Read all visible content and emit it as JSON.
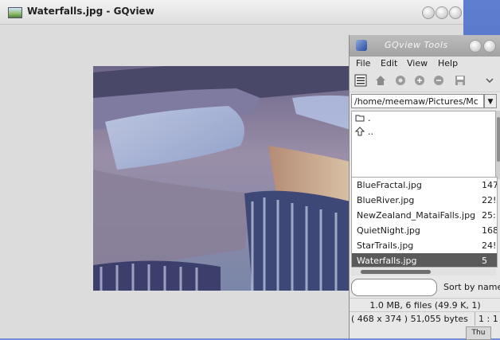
{
  "main_window": {
    "title": "Waterfalls.jpg - GQview"
  },
  "tools_window": {
    "title": "GQview Tools",
    "menu": [
      "File",
      "Edit",
      "View",
      "Help"
    ],
    "path": "/home/meemaw/Pictures/Mc",
    "dirs": [
      ".",
      ".."
    ],
    "files": [
      {
        "name": "BlueFractal.jpg",
        "size": "147"
      },
      {
        "name": "BlueRiver.jpg",
        "size": "22!"
      },
      {
        "name": "NewZealand_MataiFalls.jpg",
        "size": "25:"
      },
      {
        "name": "QuietNight.jpg",
        "size": "168"
      },
      {
        "name": "StarTrails.jpg",
        "size": "24!"
      },
      {
        "name": "Waterfalls.jpg",
        "size": "5"
      }
    ],
    "selected_file": "Waterfalls.jpg",
    "sort_label": "Sort by name",
    "status_files": "1.0 MB, 6 files (49.9 K, 1)",
    "status_image": "( 468 x 374 ) 51,055 bytes",
    "zoom": "1 : 1"
  },
  "taskbar": {
    "clock_label": "Thu"
  },
  "colors": {
    "desktop": "#6f8fd0",
    "selection": "#5a5a5a"
  }
}
